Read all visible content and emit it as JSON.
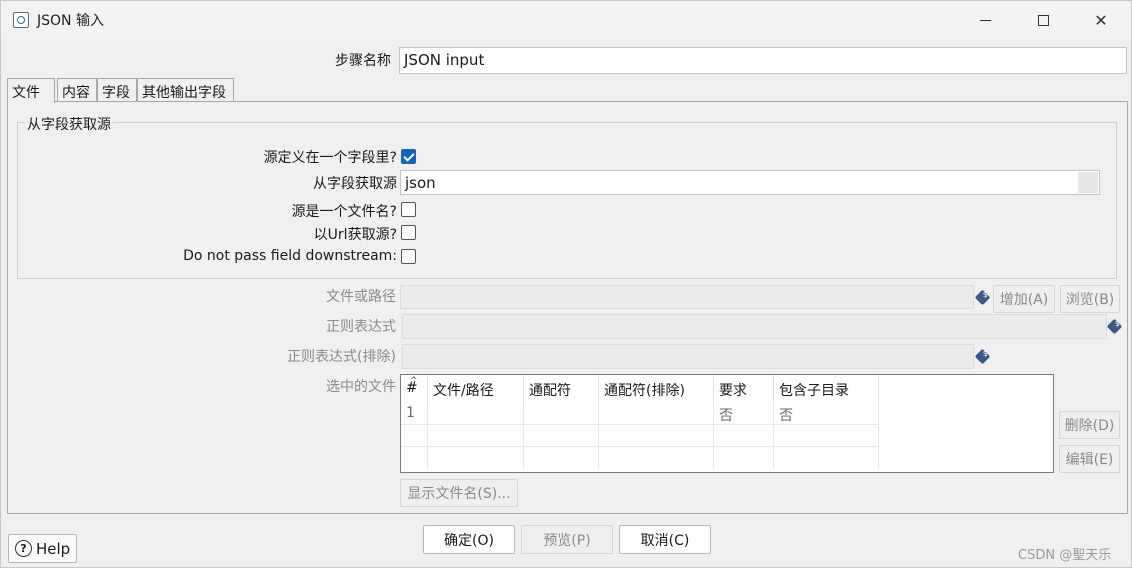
{
  "window": {
    "title": "JSON 输入"
  },
  "step": {
    "label": "步骤名称",
    "value": "JSON input"
  },
  "tabs": [
    {
      "label": "文件",
      "active": true
    },
    {
      "label": "内容",
      "active": false
    },
    {
      "label": "字段",
      "active": false
    },
    {
      "label": "其他输出字段",
      "active": false
    }
  ],
  "source_group": {
    "title": "从字段获取源",
    "defined_in_field": {
      "label": "源定义在一个字段里?",
      "checked": true
    },
    "source_field": {
      "label": "从字段获取源",
      "value": "json"
    },
    "is_filename": {
      "label": "源是一个文件名?",
      "checked": false
    },
    "from_url": {
      "label": "以Url获取源?",
      "checked": false
    },
    "no_pass": {
      "label": "Do not pass field downstream:",
      "checked": false
    }
  },
  "file_section": {
    "path_label": "文件或路径",
    "regex_label": "正则表达式",
    "regex_exclude_label": "正则表达式(排除)",
    "selected_label": "选中的文件",
    "add_button": "增加(A)",
    "browse_button": "浏览(B)",
    "delete_button": "删除(D)",
    "edit_button": "编辑(E)",
    "show_files_button": "显示文件名(S)...",
    "variable_icon": "$"
  },
  "files_table": {
    "columns": [
      "#",
      "文件/路径",
      "通配符",
      "通配符(排除)",
      "要求",
      "包含子目录"
    ],
    "rows": [
      [
        "1",
        "",
        "",
        "",
        "否",
        "否"
      ]
    ]
  },
  "footer": {
    "help": "Help",
    "ok": "确定(O)",
    "preview": "预览(P)",
    "cancel": "取消(C)",
    "watermark": "CSDN @聖天乐"
  },
  "icons": {
    "app": "json-input-icon",
    "help": "help-icon",
    "check": "checkmark-icon",
    "variable": "variable-dollar-icon"
  },
  "colors": {
    "accent": "#1565c0",
    "variable_icon": "#3b5a86"
  }
}
